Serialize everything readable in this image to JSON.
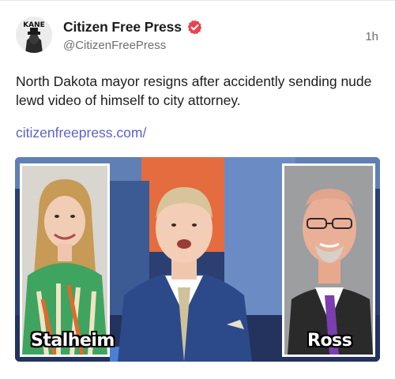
{
  "post": {
    "author_name": "Citizen Free Press",
    "handle": "@CitizenFreePress",
    "time": "1h",
    "text": "North Dakota mayor resigns after accidently sending nude lewd video of himself to city attorney.",
    "link": "citizenfreepress.com/",
    "avatar_text": "KANE",
    "verified_color": "#e8434d",
    "link_color": "#5b62c9"
  },
  "media": {
    "left_caption": "Stalheim",
    "right_caption": "Ross"
  }
}
